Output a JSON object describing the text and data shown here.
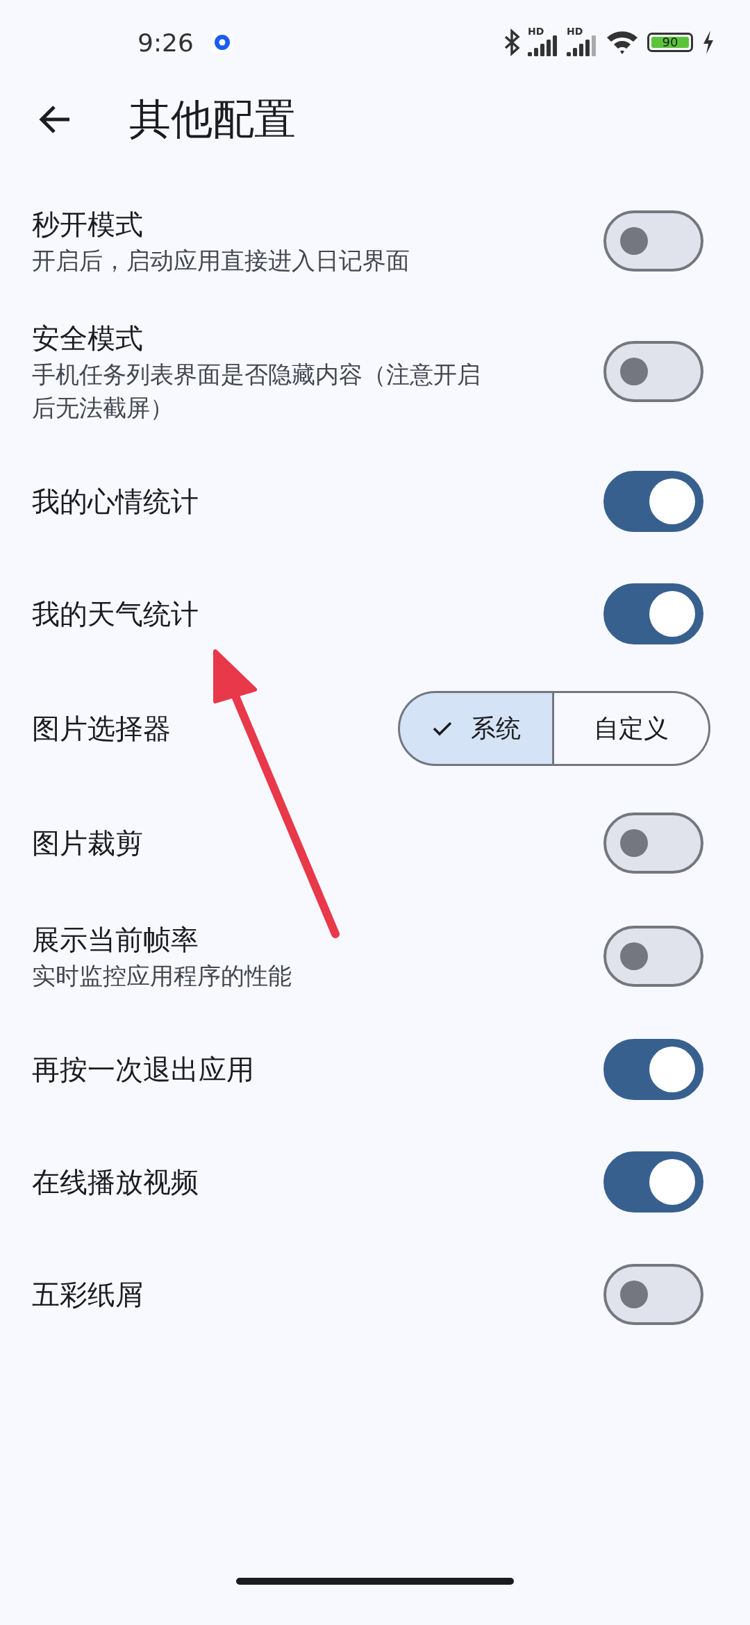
{
  "status_bar": {
    "time": "9:26",
    "signals": [
      {
        "label": "HD"
      },
      {
        "label": "HD"
      }
    ],
    "battery": "90",
    "charging": true
  },
  "header": {
    "title": "其他配置"
  },
  "settings": [
    {
      "kind": "toggle",
      "title": "秒开模式",
      "subtitle": "开启后，启动应用直接进入日记界面",
      "on": false
    },
    {
      "kind": "toggle",
      "title": "安全模式",
      "subtitle": "手机任务列表界面是否隐藏内容（注意开启后无法截屏）",
      "on": false
    },
    {
      "kind": "toggle",
      "title": "我的心情统计",
      "on": true
    },
    {
      "kind": "toggle",
      "title": "我的天气统计",
      "on": true
    },
    {
      "kind": "segmented",
      "title": "图片选择器",
      "options": [
        {
          "label": "系统",
          "selected": true
        },
        {
          "label": "自定义",
          "selected": false
        }
      ]
    },
    {
      "kind": "toggle",
      "title": "图片裁剪",
      "on": false
    },
    {
      "kind": "toggle",
      "title": "展示当前帧率",
      "subtitle": "实时监控应用程序的性能",
      "on": false
    },
    {
      "kind": "toggle",
      "title": "再按一次退出应用",
      "on": true
    },
    {
      "kind": "toggle",
      "title": "在线播放视频",
      "on": true
    },
    {
      "kind": "toggle",
      "title": "五彩纸屑",
      "on": false
    }
  ]
}
